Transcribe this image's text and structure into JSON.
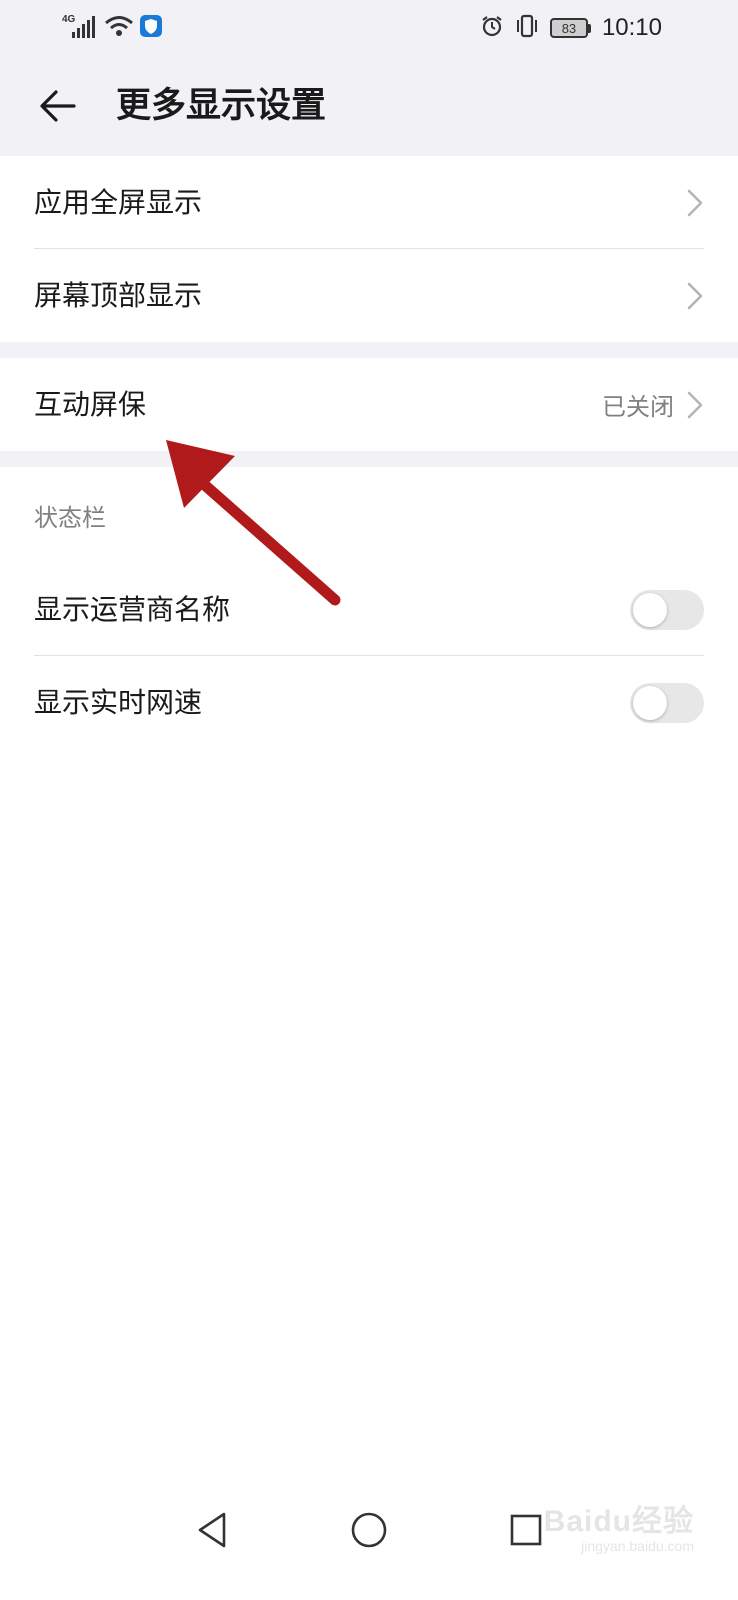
{
  "status_bar": {
    "network": "4G",
    "time": "10:10",
    "battery": "83",
    "icons": [
      "signal-icon",
      "wifi-icon",
      "shield-app-icon",
      "alarm-icon",
      "vibrate-icon",
      "battery-icon"
    ]
  },
  "header": {
    "title": "更多显示设置",
    "back_icon": "arrow-left-icon"
  },
  "groups": [
    {
      "items": [
        {
          "label": "应用全屏显示",
          "type": "link"
        },
        {
          "label": "屏幕顶部显示",
          "type": "link"
        }
      ]
    },
    {
      "items": [
        {
          "label": "互动屏保",
          "value": "已关闭",
          "type": "link"
        }
      ]
    },
    {
      "header": "状态栏",
      "items": [
        {
          "label": "显示运营商名称",
          "type": "toggle",
          "on": false
        },
        {
          "label": "显示实时网速",
          "type": "toggle",
          "on": false
        }
      ]
    }
  ],
  "annotation": {
    "color": "#b01a1a",
    "icon": "red-arrow-annotation"
  },
  "navbar": {
    "icons": [
      "back-triangle-icon",
      "home-circle-icon",
      "recents-square-icon"
    ]
  },
  "watermark": {
    "main": "Baidu经验",
    "sub": "jingyan.baidu.com"
  },
  "colors": {
    "background": "#f2f1f6",
    "card": "#ffffff",
    "secondary_text": "#808080",
    "toggle_off": "#e7e7e7"
  }
}
